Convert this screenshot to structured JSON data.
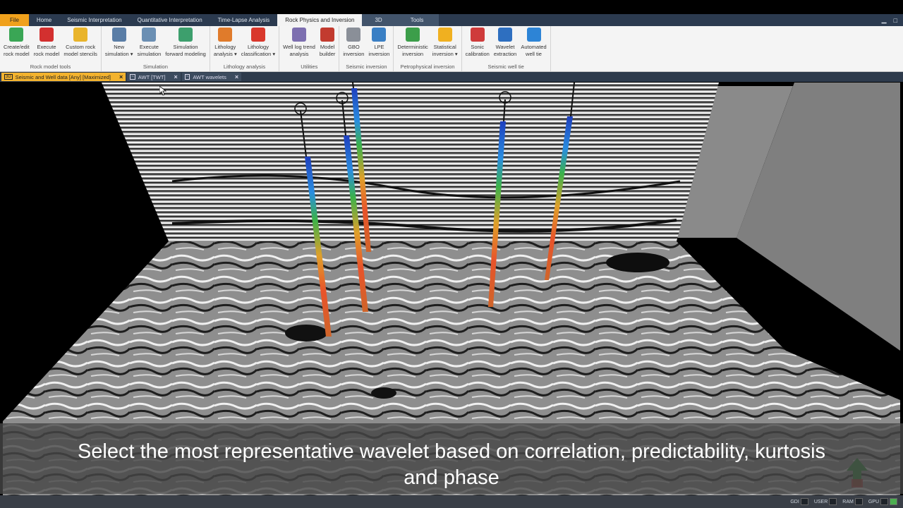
{
  "app": {
    "file_label": "File",
    "tabs": [
      "Home",
      "Seismic Interpretation",
      "Quantitative Interpretation",
      "Time-Lapse Analysis",
      "Rock Physics and Inversion",
      "3D",
      "Tools"
    ],
    "active_tab": "Rock Physics and Inversion",
    "window_controls": [
      "▁",
      "□"
    ]
  },
  "ribbon": {
    "groups": [
      {
        "label": "Rock model tools",
        "buttons": [
          {
            "line1": "Create/edit",
            "line2": "rock model",
            "icon": "rock-model-edit-icon",
            "color": "#3aa655"
          },
          {
            "line1": "Execute",
            "line2": "rock model",
            "icon": "execute-rock-model-icon",
            "color": "#d3302f"
          },
          {
            "line1": "Custom rock",
            "line2": "model stencils",
            "icon": "stencil-icon",
            "color": "#e9b42b"
          }
        ]
      },
      {
        "label": "Simulation",
        "buttons": [
          {
            "line1": "New",
            "line2": "simulation ▾",
            "icon": "grid-simulation-icon",
            "color": "#5a7da6"
          },
          {
            "line1": "Execute",
            "line2": "simulation",
            "icon": "execute-simulation-icon",
            "color": "#6b8fb3"
          },
          {
            "line1": "Simulation",
            "line2": "forward modeling",
            "icon": "forward-modeling-icon",
            "color": "#3d9f6d"
          }
        ]
      },
      {
        "label": "Lithology analysis",
        "buttons": [
          {
            "line1": "Lithology",
            "line2": "analysis ▾",
            "icon": "lithology-analysis-icon",
            "color": "#e07b2b"
          },
          {
            "line1": "Lithology",
            "line2": "classification ▾",
            "icon": "lithology-classification-icon",
            "color": "#d9382c"
          }
        ]
      },
      {
        "label": "Utilities",
        "buttons": [
          {
            "line1": "Well log trend",
            "line2": "analysis",
            "icon": "log-trend-icon",
            "color": "#7d6fb0"
          },
          {
            "line1": "Model",
            "line2": "builder",
            "icon": "model-builder-icon",
            "color": "#c23b2f"
          }
        ]
      },
      {
        "label": "Seismic inversion",
        "buttons": [
          {
            "line1": "GBO",
            "line2": "inversion",
            "icon": "gbo-inversion-icon",
            "color": "#8a8f98"
          },
          {
            "line1": "LPE",
            "line2": "inversion",
            "icon": "lpe-inversion-icon",
            "color": "#3a7fc4"
          }
        ]
      },
      {
        "label": "Petrophysical inversion",
        "buttons": [
          {
            "line1": "Deterministic",
            "line2": "inversion",
            "icon": "deterministic-inversion-icon",
            "color": "#3c9e4a"
          },
          {
            "line1": "Statistical",
            "line2": "inversion ▾",
            "icon": "statistical-inversion-icon",
            "color": "#f0b020"
          }
        ]
      },
      {
        "label": "Seismic well tie",
        "buttons": [
          {
            "line1": "Sonic",
            "line2": "calibration",
            "icon": "sonic-calibration-icon",
            "color": "#cf3b3b"
          },
          {
            "line1": "Wavelet",
            "line2": "extraction",
            "icon": "wavelet-extraction-icon",
            "color": "#2e6fc0"
          },
          {
            "line1": "Automated",
            "line2": "well tie",
            "icon": "automated-well-tie-icon",
            "color": "#2d84d6"
          }
        ]
      }
    ]
  },
  "doc_tabs": [
    {
      "tag": "3D",
      "label": "Seismic and Well data [Any] [Maximized]",
      "active": true
    },
    {
      "tag": "~",
      "label": "AWT [TWT]",
      "active": false
    },
    {
      "tag": "~",
      "label": "AWT wavelets",
      "active": false
    }
  ],
  "caption": {
    "line1": "Select the most representative wavelet based on correlation, predictability, kurtosis",
    "line2": "and phase"
  },
  "status": {
    "items": [
      "GDI",
      "USER",
      "RAM",
      "GPU"
    ]
  },
  "colors": {
    "accent": "#f0a11c",
    "tabbar": "#2b3a4f",
    "ribbon": "#f4f4f4"
  }
}
